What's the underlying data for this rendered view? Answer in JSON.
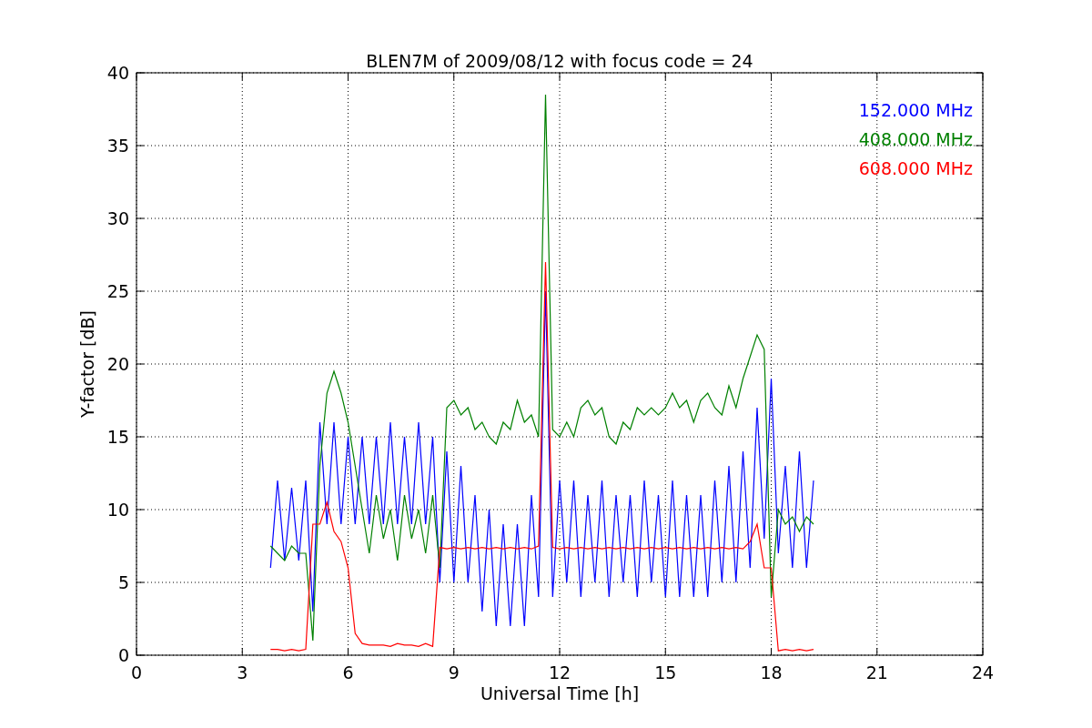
{
  "chart_data": {
    "type": "line",
    "title": "BLEN7M of 2009/08/12 with focus code = 24",
    "xlabel": "Universal Time [h]",
    "ylabel": "Y-factor [dB]",
    "xlim": [
      0,
      24
    ],
    "ylim": [
      0,
      40
    ],
    "xticks": [
      0,
      3,
      6,
      9,
      12,
      15,
      18,
      21,
      24
    ],
    "yticks": [
      0,
      5,
      10,
      15,
      20,
      25,
      30,
      35,
      40
    ],
    "grid": true,
    "x": [
      3.8,
      4.0,
      4.2,
      4.4,
      4.6,
      4.8,
      5.0,
      5.2,
      5.4,
      5.6,
      5.8,
      6.0,
      6.2,
      6.4,
      6.6,
      6.8,
      7.0,
      7.2,
      7.4,
      7.6,
      7.8,
      8.0,
      8.2,
      8.4,
      8.6,
      8.8,
      9.0,
      9.2,
      9.4,
      9.6,
      9.8,
      10.0,
      10.2,
      10.4,
      10.6,
      10.8,
      11.0,
      11.2,
      11.4,
      11.6,
      11.8,
      12.0,
      12.2,
      12.4,
      12.6,
      12.8,
      13.0,
      13.2,
      13.4,
      13.6,
      13.8,
      14.0,
      14.2,
      14.4,
      14.6,
      14.8,
      15.0,
      15.2,
      15.4,
      15.6,
      15.8,
      16.0,
      16.2,
      16.4,
      16.6,
      16.8,
      17.0,
      17.2,
      17.4,
      17.6,
      17.8,
      18.0,
      18.2,
      18.4,
      18.6,
      18.8,
      19.0,
      19.2
    ],
    "series": [
      {
        "name": "152.000 MHz",
        "color": "#0000ff",
        "values": [
          6,
          12,
          6.5,
          11.5,
          6.5,
          12,
          3,
          16,
          9,
          16,
          9,
          15,
          9,
          15,
          9,
          15,
          9,
          16,
          9,
          15,
          9,
          16,
          9,
          15,
          5,
          14,
          5,
          13,
          5,
          11,
          3,
          10,
          2,
          9,
          2,
          9,
          2,
          11,
          4,
          25,
          4,
          12,
          5,
          12,
          4,
          11,
          5,
          12,
          4,
          11,
          5,
          11,
          4,
          12,
          5,
          11,
          4,
          12,
          4,
          11,
          4,
          11,
          4,
          12,
          5,
          13,
          5,
          14,
          6,
          17,
          8,
          19,
          7,
          13,
          6,
          14,
          6,
          12
        ]
      },
      {
        "name": "408.000 MHz",
        "color": "#008000",
        "values": [
          7.5,
          7,
          6.5,
          7.5,
          7,
          7,
          1,
          13,
          18,
          19.5,
          18,
          16,
          13,
          10,
          7,
          11,
          8,
          10,
          6.5,
          11,
          8,
          10,
          7,
          11,
          6,
          17,
          17.5,
          16.5,
          17,
          15.5,
          16,
          15,
          14.5,
          16,
          15.5,
          17.5,
          16,
          16.5,
          15,
          38.5,
          15.5,
          15,
          16,
          15,
          17,
          17.5,
          16.5,
          17,
          15,
          14.5,
          16,
          15.5,
          17,
          16.5,
          17,
          16.5,
          17,
          18,
          17,
          17.5,
          16,
          17.5,
          18,
          17,
          16.5,
          18.5,
          17,
          19,
          20.5,
          22,
          21,
          4,
          10,
          9,
          9.5,
          8.5,
          9.5,
          9
        ]
      },
      {
        "name": "608.000 MHz",
        "color": "#ff0000",
        "values": [
          0.4,
          0.4,
          0.3,
          0.4,
          0.3,
          0.4,
          9,
          9,
          10.5,
          8.5,
          7.8,
          6,
          1.5,
          0.8,
          0.7,
          0.7,
          0.7,
          0.6,
          0.8,
          0.7,
          0.7,
          0.6,
          0.8,
          0.6,
          7.4,
          7.3,
          7.4,
          7.3,
          7.4,
          7.3,
          7.4,
          7.3,
          7.4,
          7.3,
          7.4,
          7.3,
          7.4,
          7.3,
          7.5,
          27,
          7.4,
          7.3,
          7.4,
          7.3,
          7.4,
          7.3,
          7.4,
          7.3,
          7.4,
          7.3,
          7.4,
          7.3,
          7.4,
          7.3,
          7.4,
          7.3,
          7.4,
          7.3,
          7.4,
          7.3,
          7.4,
          7.3,
          7.4,
          7.3,
          7.4,
          7.3,
          7.4,
          7.3,
          7.8,
          9,
          6,
          6,
          0.3,
          0.4,
          0.3,
          0.4,
          0.3,
          0.4
        ]
      }
    ]
  }
}
